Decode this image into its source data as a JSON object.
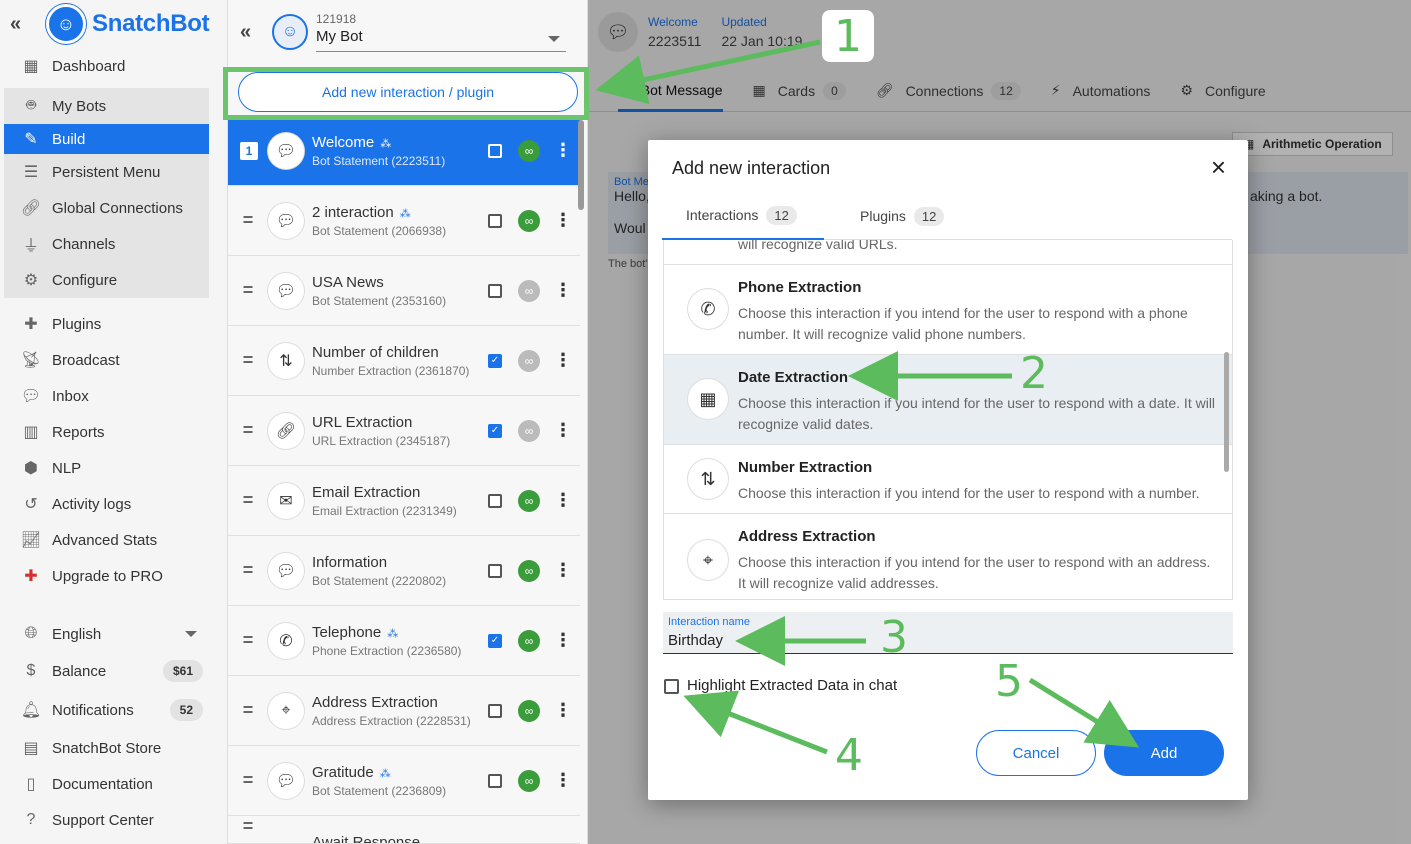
{
  "nav": {
    "brand": "SnatchBot",
    "items": [
      {
        "label": "Dashboard",
        "icon": "dashboard-icon"
      },
      {
        "label": "My Bots",
        "icon": "robot-icon"
      },
      {
        "label": "Build",
        "icon": "edit-icon"
      },
      {
        "label": "Persistent Menu",
        "icon": "menu-icon"
      },
      {
        "label": "Global Connections",
        "icon": "link-icon"
      },
      {
        "label": "Channels",
        "icon": "plug-icon"
      },
      {
        "label": "Configure",
        "icon": "gear-icon"
      },
      {
        "label": "Plugins",
        "icon": "puzzle-icon"
      },
      {
        "label": "Broadcast",
        "icon": "broadcast-icon"
      },
      {
        "label": "Inbox",
        "icon": "chat-icon"
      },
      {
        "label": "Reports",
        "icon": "bar-chart-icon"
      },
      {
        "label": "NLP",
        "icon": "nlp-icon"
      },
      {
        "label": "Activity logs",
        "icon": "history-icon"
      },
      {
        "label": "Advanced Stats",
        "icon": "line-chart-icon"
      },
      {
        "label": "Upgrade to PRO",
        "icon": "plus-circle-icon"
      }
    ],
    "language": "English",
    "balance_label": "Balance",
    "balance_value": "$61",
    "notifications_label": "Notifications",
    "notifications_count": "52",
    "store": "SnatchBot Store",
    "documentation": "Documentation",
    "support": "Support Center"
  },
  "bot": {
    "id": "121918",
    "name": "My Bot",
    "add_button": "Add new interaction / plugin"
  },
  "interactions": [
    {
      "name": "Welcome",
      "sub": "Bot Statement (2223511)",
      "icon": "chat-icon",
      "num": "1"
    },
    {
      "name": "2 interaction",
      "sub": "Bot Statement (2066938)",
      "icon": "chat-icon"
    },
    {
      "name": "USA News",
      "sub": "Bot Statement (2353160)",
      "icon": "chat-icon"
    },
    {
      "name": "Number of children",
      "sub": "Number Extraction (2361870)",
      "icon": "number-icon"
    },
    {
      "name": "URL Extraction",
      "sub": "URL Extraction (2345187)",
      "icon": "link-icon"
    },
    {
      "name": "Email Extraction",
      "sub": "Email Extraction (2231349)",
      "icon": "envelope-icon"
    },
    {
      "name": "Information",
      "sub": "Bot Statement (2220802)",
      "icon": "chat-icon"
    },
    {
      "name": "Telephone",
      "sub": "Phone Extraction (2236580)",
      "icon": "phone-icon"
    },
    {
      "name": "Address Extraction",
      "sub": "Address Extraction (2228531)",
      "icon": "map-icon"
    },
    {
      "name": "Gratitude",
      "sub": "Bot Statement (2236809)",
      "icon": "chat-icon"
    },
    {
      "name": "Await Response",
      "sub": "",
      "icon": "chat-icon"
    }
  ],
  "main": {
    "welcome_label": "Welcome",
    "welcome_id": "2223511",
    "updated_label": "Updated",
    "updated_value": "22 Jan 10:19",
    "tabs": [
      {
        "label": "Bot Message",
        "count": ""
      },
      {
        "label": "Cards",
        "count": "0"
      },
      {
        "label": "Connections",
        "count": "12"
      },
      {
        "label": "Automations",
        "count": ""
      },
      {
        "label": "Configure",
        "count": ""
      }
    ],
    "toolbar_arith": "Arithmetic Operation",
    "bubble_text": "Hello,",
    "bubble_text2": "Woul",
    "bubble_right": "aking a bot.",
    "bubble_tag": "Bot Me",
    "note": "The bot'"
  },
  "modal": {
    "title": "Add new interaction",
    "tab_interactions": "Interactions",
    "tab_interactions_count": "12",
    "tab_plugins": "Plugins",
    "tab_plugins_count": "12",
    "partial_text": "will recognize valid URLs.",
    "items": [
      {
        "title": "Phone Extraction",
        "desc": "Choose this interaction if you intend for the user to respond with a phone number. It will recognize valid phone numbers.",
        "icon": "phone-icon"
      },
      {
        "title": "Date Extraction",
        "desc": "Choose this interaction if you intend for the user to respond with a date. It will recognize valid dates.",
        "icon": "calendar-icon"
      },
      {
        "title": "Number Extraction",
        "desc": "Choose this interaction if you intend for the user to respond with a number.",
        "icon": "number-icon"
      },
      {
        "title": "Address Extraction",
        "desc": "Choose this interaction if you intend for the user to respond with an address. It will recognize valid addresses.",
        "icon": "map-icon"
      }
    ],
    "field_label": "Interaction name",
    "field_value": "Birthday",
    "highlight_label": "Highlight Extracted Data in chat",
    "cancel": "Cancel",
    "add": "Add"
  },
  "annotations": {
    "step1": "1",
    "step2": "2",
    "step3": "3",
    "step4": "4",
    "step5": "5"
  },
  "colors": {
    "accent": "#1a73e8",
    "annotation": "#5cbb5c",
    "link_on": "#3a9c3a"
  }
}
